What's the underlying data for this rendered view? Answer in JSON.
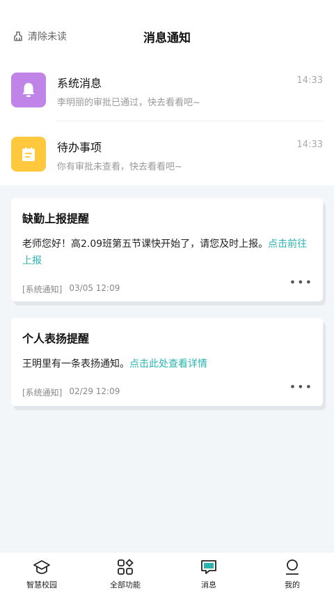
{
  "header": {
    "clear_label": "清除未读",
    "title": "消息通知"
  },
  "messages": [
    {
      "title": "系统消息",
      "desc": "李明丽的审批已通过，快去看看吧~",
      "time": "14:33",
      "icon": "bell-icon",
      "color": "#c084e8"
    },
    {
      "title": "待办事项",
      "desc": "你有审批未查看，快去看看吧~",
      "time": "14:33",
      "icon": "notepad-icon",
      "color": "#ffc83d"
    }
  ],
  "cards": [
    {
      "title": "缺勤上报提醒",
      "body": "老师您好！高2.09班第五节课快开始了，请您及时上报。",
      "link": "点击前往上报",
      "tag": "[系统通知]",
      "time": "03/05 12:09"
    },
    {
      "title": "个人表扬提醒",
      "body": "王明里有一条表扬通知。",
      "link": "点击此处查看详情",
      "tag": "[系统通知]",
      "time": "02/29 12:09"
    }
  ],
  "more_label": "•••",
  "tabs": [
    {
      "label": "智慧校园",
      "icon": "graduation-cap-icon"
    },
    {
      "label": "全部功能",
      "icon": "apps-grid-icon"
    },
    {
      "label": "消息",
      "icon": "chat-icon"
    },
    {
      "label": "我的",
      "icon": "user-icon"
    }
  ],
  "colors": {
    "link": "#2bb3b1",
    "chat_accent": "#2bb3b1"
  }
}
